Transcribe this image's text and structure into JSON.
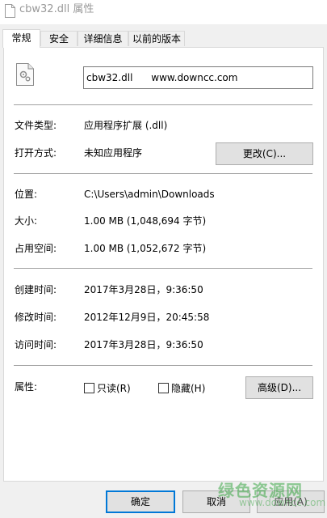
{
  "window": {
    "title": "cbw32.dll 属性"
  },
  "tabs": [
    {
      "label": "常规"
    },
    {
      "label": "安全"
    },
    {
      "label": "详细信息"
    },
    {
      "label": "以前的版本"
    }
  ],
  "file": {
    "name_field": "cbw32.dll      www.downcc.com"
  },
  "props": {
    "type_label": "文件类型:",
    "type_value": "应用程序扩展 (.dll)",
    "open_label": "打开方式:",
    "open_value": "未知应用程序",
    "change_button": "更改(C)...",
    "location_label": "位置:",
    "location_value": "C:\\Users\\admin\\Downloads",
    "size_label": "大小:",
    "size_value": "1.00 MB (1,048,694 字节)",
    "disk_label": "占用空间:",
    "disk_value": "1.00 MB (1,052,672 字节)",
    "created_label": "创建时间:",
    "created_value": "2017年3月28日，9:36:50",
    "modified_label": "修改时间:",
    "modified_value": "2012年12月9日，20:45:58",
    "accessed_label": "访问时间:",
    "accessed_value": "2017年3月28日，9:36:50",
    "attr_label": "属性:",
    "readonly_label": "只读(R)",
    "hidden_label": "隐藏(H)",
    "readonly_checked": false,
    "hidden_checked": false,
    "advanced_button": "高级(D)..."
  },
  "footer": {
    "ok": "确定",
    "cancel": "取消",
    "apply": "应用(A)"
  },
  "watermark": {
    "text": "绿色资源网",
    "url": "www.downcc.com"
  }
}
